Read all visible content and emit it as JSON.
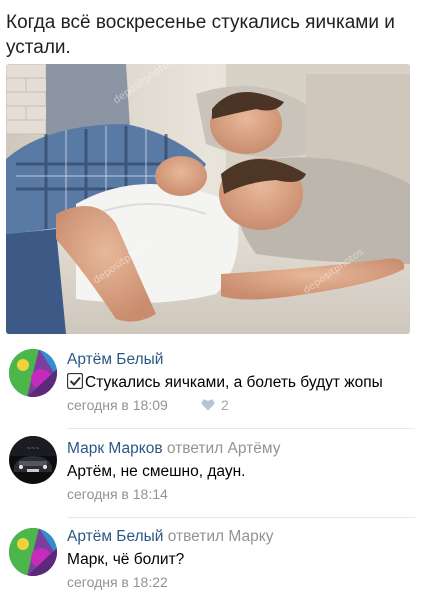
{
  "post": {
    "text": "Когда всё воскресенье стукались яичками и устали.",
    "watermark": "depositphotos"
  },
  "comments": [
    {
      "author": "Артём Белый",
      "reply_prefix": "",
      "reply_to": "",
      "text": "Стукались яичками, а болеть будут жопы",
      "date": "сегодня в 18:09",
      "likes": "2",
      "avatar": "purple-green-abstract-avatar"
    },
    {
      "author": "Марк Марков",
      "reply_prefix": "ответил",
      "reply_to": "Артёму",
      "text": "Артём, не смешно, даун.",
      "date": "сегодня в 18:14",
      "avatar": "dark-car-avatar"
    },
    {
      "author": "Артём Белый",
      "reply_prefix": "ответил",
      "reply_to": "Марку",
      "text": "Марк, чё болит?",
      "date": "сегодня в 18:22",
      "avatar": "purple-green-abstract-avatar"
    }
  ],
  "colors": {
    "link": "#2a5885",
    "meta": "#939393",
    "like": "#99a6b4"
  }
}
